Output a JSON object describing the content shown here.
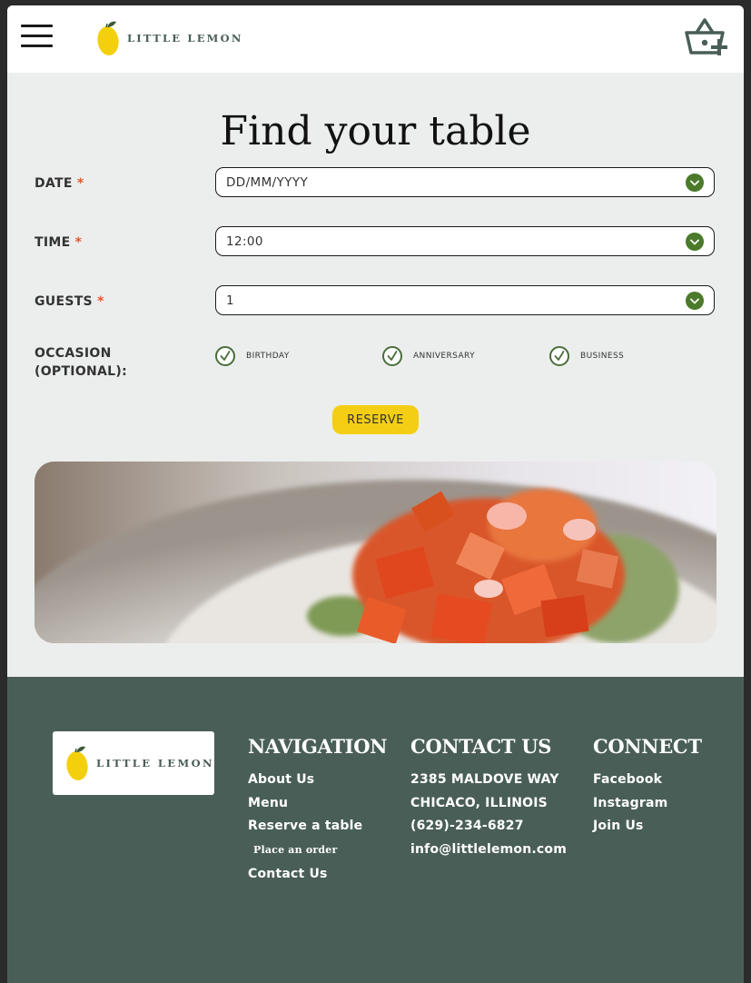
{
  "header": {
    "menu_icon": "hamburger-icon",
    "brand": "LITTLE LEMON",
    "basket_icon": "basket-add-icon"
  },
  "booking": {
    "title": "Find your table",
    "required_mark": "*",
    "date": {
      "label": "DATE",
      "placeholder": "DD/MM/YYYY"
    },
    "time": {
      "label": "TIME",
      "value": "12:00"
    },
    "guests": {
      "label": "GUESTS",
      "value": "1"
    },
    "occasion": {
      "label_line1": "OCCASION",
      "label_line2": "(OPTIONAL):",
      "options": [
        "BIRTHDAY",
        "ANNIVERSARY",
        "BUSINESS"
      ]
    },
    "reserve_label": "RESERVE"
  },
  "colors": {
    "brand_green": "#495e57",
    "brand_yellow": "#f4ce14",
    "dropdown_green": "#4a7a2a",
    "required_orange": "#e05a2b"
  },
  "footer": {
    "brand": "LITTLE LEMON",
    "navigation": {
      "title": "NAVIGATION",
      "items": [
        "About Us",
        "Menu",
        "Reserve a table",
        "Place an order",
        "Contact Us"
      ]
    },
    "contact": {
      "title": "CONTACT US",
      "items": [
        "2385 MALDOVE WAY",
        "CHICACO, ILLINOIS",
        "(629)-234-6827",
        "info@littlelemon.com"
      ]
    },
    "connect": {
      "title": "CONNECT",
      "items": [
        "Facebook",
        "Instagram",
        "Join Us"
      ]
    }
  }
}
